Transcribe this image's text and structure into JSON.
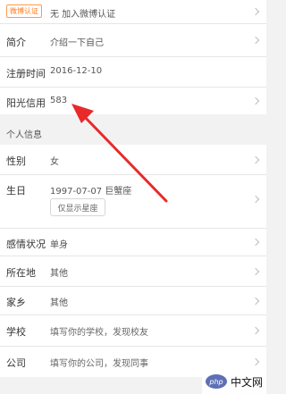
{
  "profile": {
    "rows": [
      {
        "badge": "微博认证",
        "value": "无 加入微博认证"
      },
      {
        "label": "简介",
        "value": "介绍一下自己"
      },
      {
        "label": "注册时间",
        "value": "2016-12-10"
      },
      {
        "label": "阳光信用",
        "value": "583"
      }
    ],
    "section_title": "个人信息",
    "info_rows": [
      {
        "label": "性别",
        "value": "女"
      },
      {
        "label": "生日",
        "value": "1997-07-07 巨蟹座",
        "button": "仅显示星座"
      },
      {
        "label": "感情状况",
        "value": "单身"
      },
      {
        "label": "所在地",
        "value": "其他"
      },
      {
        "label": "家乡",
        "value": "其他"
      },
      {
        "label": "学校",
        "value": "填写你的学校，发现校友"
      },
      {
        "label": "公司",
        "value": "填写你的公司，发现同事"
      }
    ]
  },
  "watermark": {
    "logo": "php",
    "text": "中文网"
  },
  "colors": {
    "badge": "#ff7a1a",
    "arrow": "#e82a2a"
  }
}
